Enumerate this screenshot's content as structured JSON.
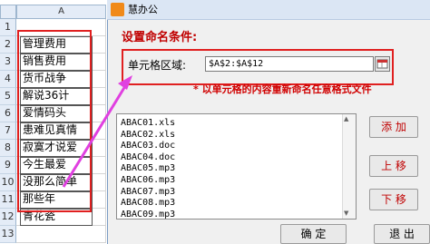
{
  "sheet": {
    "column_header": "A",
    "rows": [
      {
        "num": "1",
        "value": ""
      },
      {
        "num": "2",
        "value": "管理费用"
      },
      {
        "num": "3",
        "value": "销售费用"
      },
      {
        "num": "4",
        "value": "货币战争"
      },
      {
        "num": "5",
        "value": "解说36计"
      },
      {
        "num": "6",
        "value": "爱情码头"
      },
      {
        "num": "7",
        "value": "患难见真情"
      },
      {
        "num": "8",
        "value": "寂寞才说爱"
      },
      {
        "num": "9",
        "value": "今生最爱"
      },
      {
        "num": "10",
        "value": "没那么简单"
      },
      {
        "num": "11",
        "value": "那些年"
      },
      {
        "num": "12",
        "value": "青花瓷"
      },
      {
        "num": "13",
        "value": ""
      }
    ]
  },
  "dialog": {
    "title": "慧办公",
    "section_title": "设置命名条件:",
    "range_label": "单元格区域:",
    "range_value": "$A$2:$A$12",
    "hint": "* 以单元格的内容重新命名任意格式文件",
    "files": [
      "ABAC01.xls",
      "ABAC02.xls",
      "ABAC03.doc",
      "ABAC04.doc",
      "ABAC05.mp3",
      "ABAC06.mp3",
      "ABAC07.mp3",
      "ABAC08.mp3",
      "ABAC09.mp3"
    ],
    "buttons": {
      "add": "添 加",
      "up": "上 移",
      "down": "下 移",
      "ok": "确 定",
      "exit": "退 出"
    }
  },
  "colors": {
    "accent_red": "#e02020",
    "arrow": "#e040e0"
  }
}
